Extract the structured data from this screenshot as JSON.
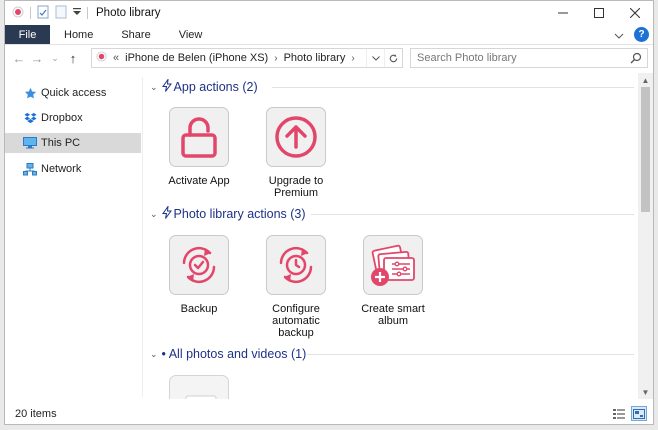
{
  "window": {
    "title": "Photo library"
  },
  "ribbon": {
    "file_label": "File",
    "tabs": [
      "Home",
      "Share",
      "View"
    ]
  },
  "address": {
    "prefix": "«",
    "crumbs": [
      "iPhone de Belen (iPhone XS)",
      "Photo library"
    ]
  },
  "search": {
    "placeholder": "Search Photo library"
  },
  "sidebar": {
    "items": [
      {
        "label": "Quick access",
        "icon": "star-icon"
      },
      {
        "label": "Dropbox",
        "icon": "dropbox-icon"
      },
      {
        "label": "This PC",
        "icon": "computer-icon",
        "selected": true
      },
      {
        "label": "Network",
        "icon": "network-icon"
      }
    ]
  },
  "groups": [
    {
      "title": "App actions (2)",
      "items": [
        {
          "label": "Activate App",
          "icon": "unlock-icon"
        },
        {
          "label": "Upgrade to Premium",
          "icon": "upgrade-arrow-icon"
        }
      ]
    },
    {
      "title": "Photo library actions (3)",
      "items": [
        {
          "label": "Backup",
          "icon": "backup-check-icon"
        },
        {
          "label": "Configure automatic backup",
          "icon": "backup-clock-icon"
        },
        {
          "label": "Create smart album",
          "icon": "smart-album-icon"
        }
      ]
    },
    {
      "title": "• All photos and videos (1)",
      "items": []
    }
  ],
  "status": {
    "item_count": "20 items"
  },
  "colors": {
    "accent": "#e2476b",
    "group_header": "#1e3287",
    "file_tab": "#2b3a53"
  }
}
